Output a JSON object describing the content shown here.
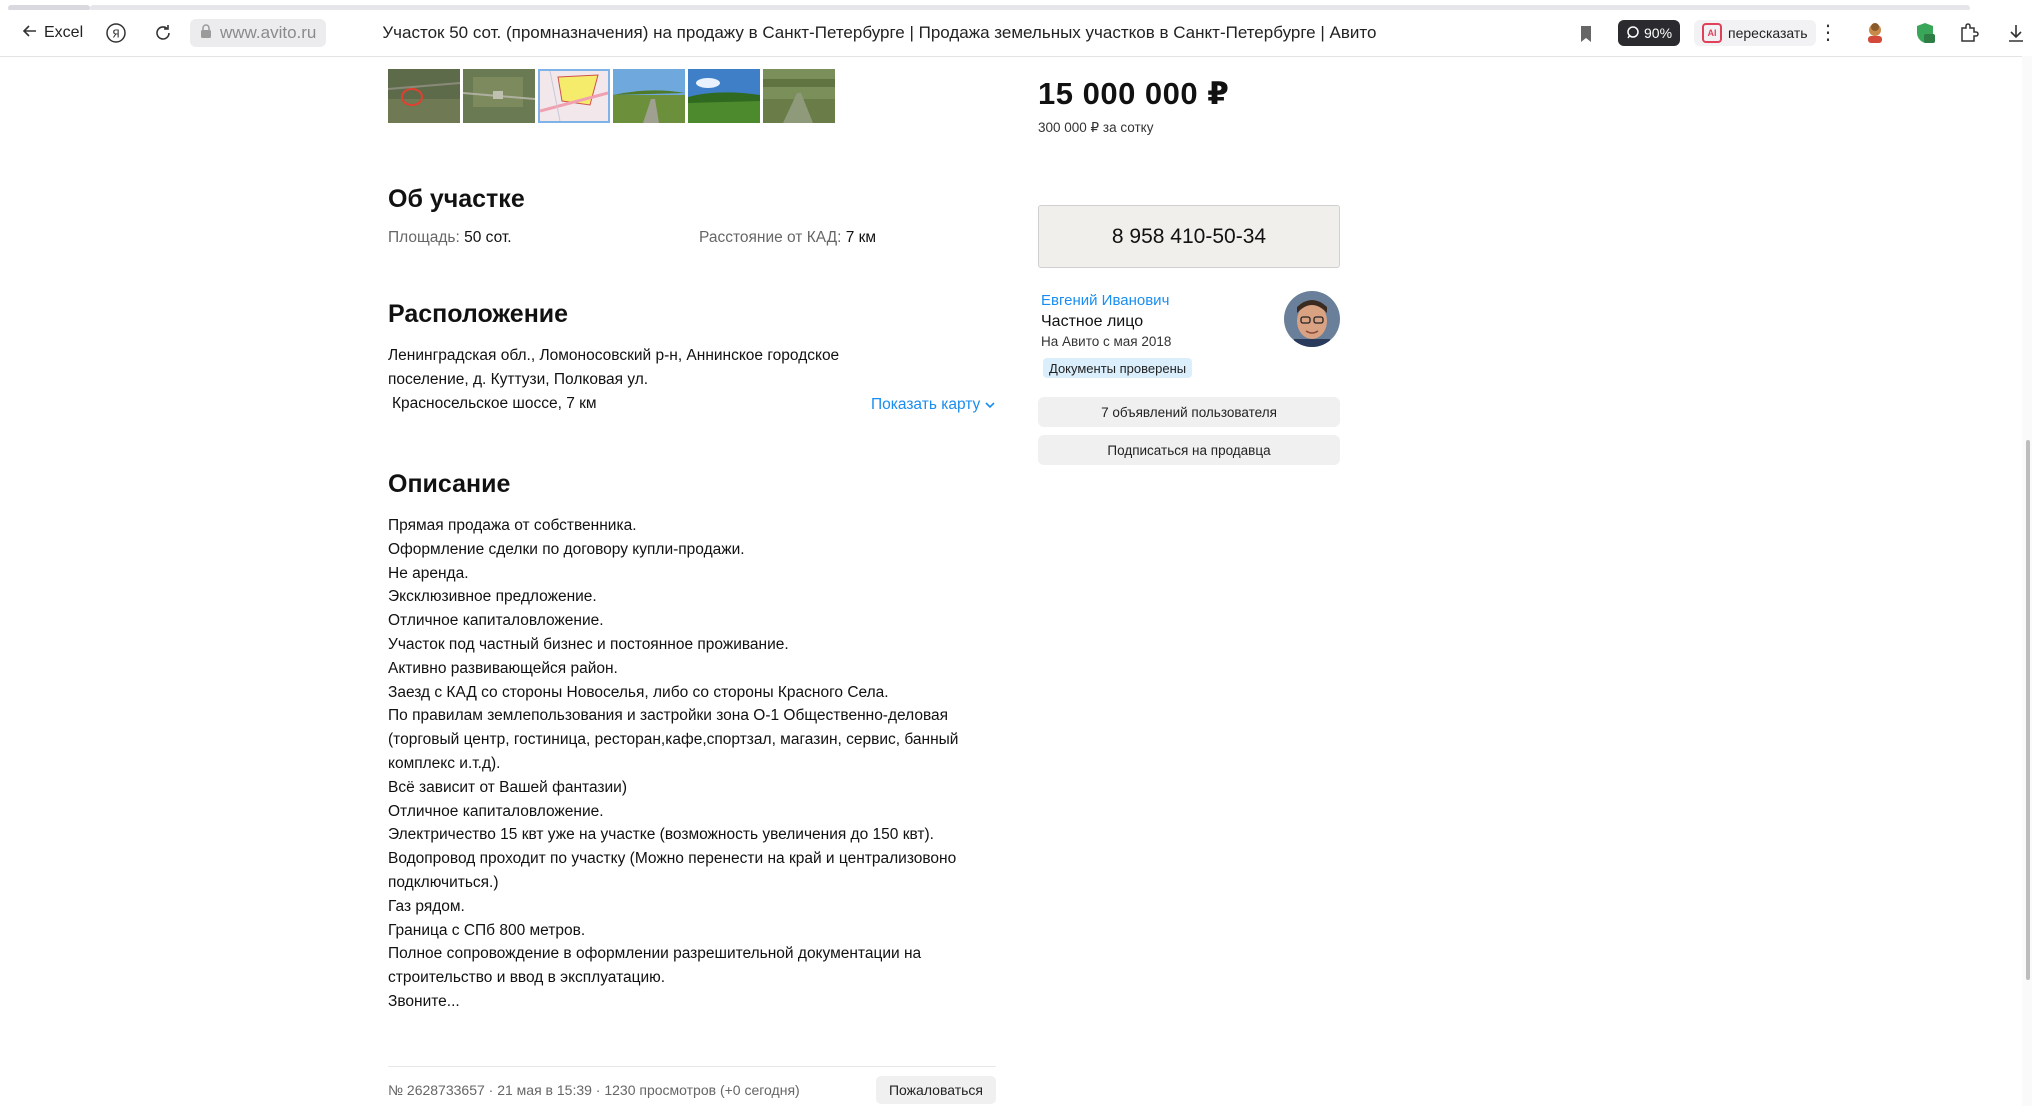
{
  "browser": {
    "back_label": "Excel",
    "url_host": "www.avito.ru",
    "page_title": "Участок 50 сот. (промназначения) на продажу в Санкт-Петербурге | Продажа земельных участков в Санкт-Петербурге | Авито",
    "zoom": "90%",
    "retell_label": "пересказать",
    "retell_badge": "AI"
  },
  "gallery": {
    "thumbnails": [
      "photo-1",
      "photo-2",
      "photo-3-plan",
      "photo-4",
      "photo-5",
      "photo-6"
    ],
    "selected_index": 2
  },
  "about": {
    "heading": "Об участке",
    "area_label": "Площадь:",
    "area_value": "50 сот.",
    "distance_label": "Расстояние от КАД:",
    "distance_value": "7 км"
  },
  "location": {
    "heading": "Расположение",
    "address_line1": "Ленинградская обл., Ломоносовский р-н, Аннинское городское",
    "address_line2": "поселение, д. Куттузи, Полковая ул.",
    "highway": "Красносельское шоссе, 7 км",
    "show_map": "Показать карту"
  },
  "description": {
    "heading": "Описание",
    "lines": [
      "Прямая продажа от собственника.",
      "Оформление сделки по договору купли-продажи.",
      "Не аренда.",
      "Эксклюзивное предложение.",
      "Отличное капиталовложение.",
      "Участок под частный бизнес и постоянное проживание.",
      "Активно развивающейся район.",
      "Заезд с КАД со стороны Новоселья, либо со стороны Красного Села.",
      "По правилам землепользования и застройки зона О-1 Общественно-деловая",
      "(торговый центр, гостиница, ресторан,кафе,спортзал, магазин, сервис, банный",
      "комплекс и.т.д).",
      "Всё зависит от Вашей фантазии)",
      "Отличное капиталовложение.",
      "Электричество 15 квт уже на участке (возможность увеличения до 150 квт).",
      "Водопровод проходит по участку (Можно перенести на край и централизовоно",
      "подключиться.)",
      "Газ рядом.",
      "Граница с СПб 800 метров.",
      "Полное сопровождение в оформлении разрешительной документации на",
      "строительство и ввод в эксплуатацию.",
      "Звоните..."
    ]
  },
  "footer": {
    "meta": "№ 2628733657 · 21 мая в 15:39 · 1230 просмотров (+0 сегодня)",
    "complain": "Пожаловаться"
  },
  "sidebar": {
    "price": "15 000 000 ₽",
    "price_per_hundred": "300 000 ₽ за сотку",
    "phone": "8 958 410-50-34",
    "seller_name": "Евгений Иванович",
    "seller_type": "Частное лицо",
    "seller_since": "На Авито с мая 2018",
    "docs_badge": "Документы проверены",
    "ads_button": "7 объявлений пользователя",
    "subscribe_button": "Подписаться на продавца"
  },
  "colors": {
    "link": "#1a8ef0",
    "phone_bg": "#f1efec",
    "badge_bg": "#dbeefc",
    "button_bg": "#f0f0f0"
  }
}
